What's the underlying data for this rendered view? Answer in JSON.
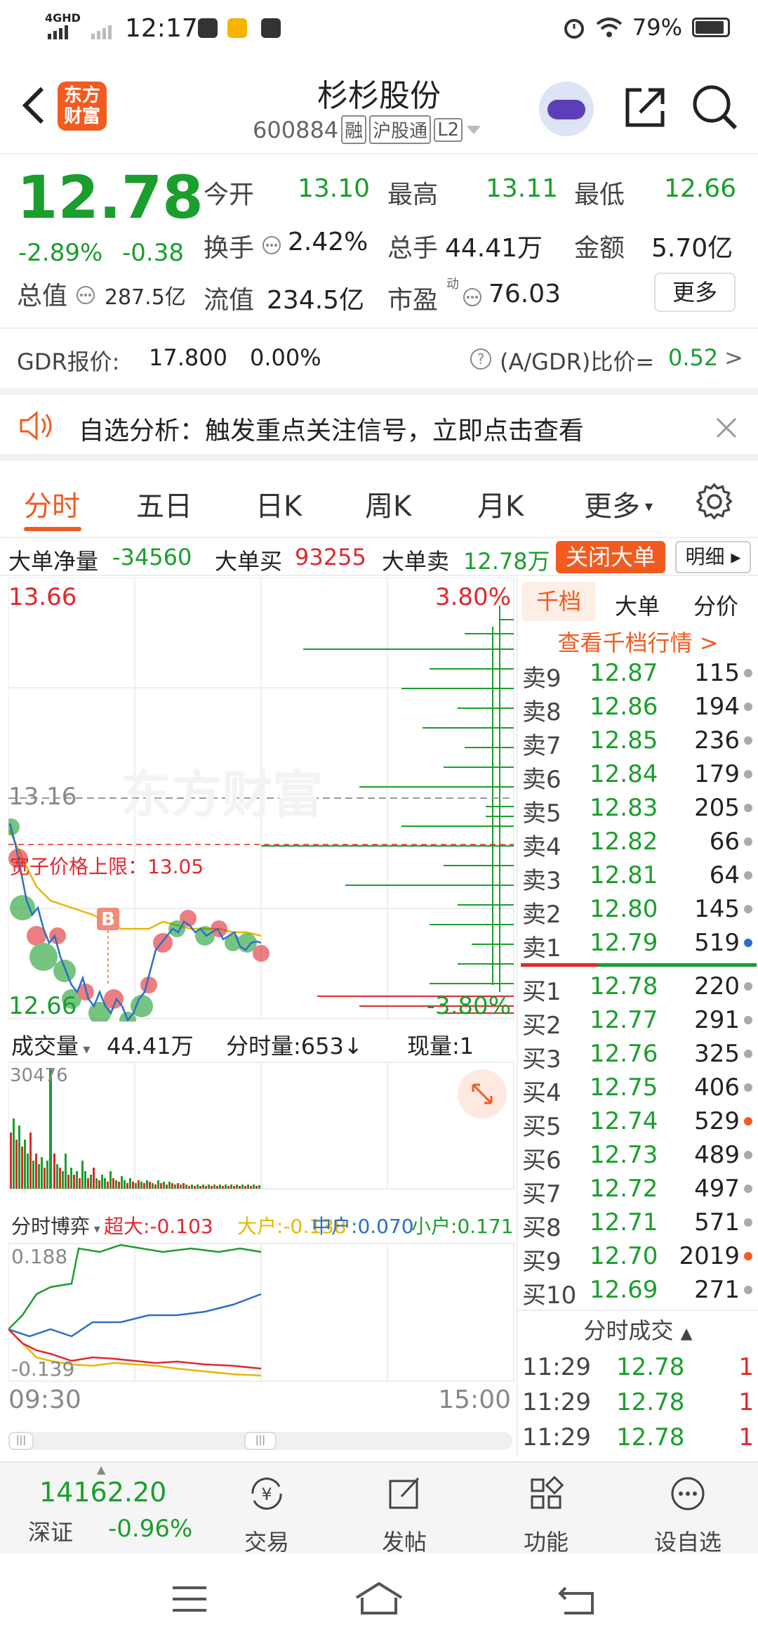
{
  "status_bar": {
    "network": "4GHD",
    "time": "12:17",
    "battery": "79%"
  },
  "header": {
    "logo_text": "东方\n财富",
    "title": "杉杉股份",
    "code": "600884",
    "tags": [
      "融",
      "沪股通",
      "L2"
    ]
  },
  "quote": {
    "price": "12.78",
    "change_pct": "-2.89%",
    "change": "-0.38",
    "fields": [
      {
        "label": "今开",
        "value": "13.10",
        "color": "green"
      },
      {
        "label": "最高",
        "value": "13.11",
        "color": "green"
      },
      {
        "label": "最低",
        "value": "12.66",
        "color": "green"
      },
      {
        "label": "换手",
        "value": "2.42%",
        "color": "dark"
      },
      {
        "label": "总手",
        "value": "44.41万",
        "color": "dark"
      },
      {
        "label": "金额",
        "value": "5.70亿",
        "color": "dark"
      },
      {
        "label": "流值",
        "value": "234.5亿",
        "color": "dark"
      },
      {
        "label": "市盈",
        "value": "76.03",
        "color": "dark"
      }
    ],
    "total_cap_label": "总值",
    "total_cap_value": "287.5亿",
    "pe_mark": "动",
    "more": "更多"
  },
  "gdr": {
    "label": "GDR报价:",
    "price": "17.800",
    "pct": "0.00%",
    "ratio_label": "(A/GDR)比价=",
    "ratio": "0.52",
    "arrow": ">"
  },
  "banner": {
    "text": "自选分析：触发重点关注信号，立即点击查看"
  },
  "tabs": [
    "分时",
    "五日",
    "日K",
    "周K",
    "月K",
    "更多"
  ],
  "big_order": {
    "net_label": "大单净量",
    "net": "-34560",
    "buy_label": "大单买",
    "buy": "93255",
    "sell_label": "大单卖",
    "sell": "12.78万",
    "close": "关闭大单",
    "detail": "明细"
  },
  "chart": {
    "price_high": "13.66",
    "price_low": "12.66",
    "pct_high": "3.80%",
    "pct_low": "-3.80%",
    "prev_close": "13.16",
    "bond_limit_label": "宽子价格上限：13.05",
    "b_marker": "B",
    "watermark": "东方财富",
    "volume_label": "成交量",
    "volume_value": "44.41万",
    "tick_volume_label": "分时量:653↓",
    "now_volume_label": "现量:1",
    "vol_max": "30476",
    "game_label": "分时博弈",
    "game_items": [
      {
        "label": "超大:",
        "value": "-0.103",
        "color": "#e0282d"
      },
      {
        "label": "大户:",
        "value": "-0.138",
        "color": "#e6b800"
      },
      {
        "label": "中户:",
        "value": "0.070",
        "color": "#2a6fc9"
      },
      {
        "label": "小户:",
        "value": "0.171",
        "color": "#1a9e2c"
      }
    ],
    "game_max": "0.188",
    "game_min": "-0.139",
    "time_start": "09:30",
    "time_end": "15:00"
  },
  "orderbook": {
    "tabs": [
      "千档",
      "大单",
      "分价"
    ],
    "link": "查看千档行情 >",
    "asks": [
      {
        "label": "卖9",
        "price": "12.87",
        "vol": "115"
      },
      {
        "label": "卖8",
        "price": "12.86",
        "vol": "194"
      },
      {
        "label": "卖7",
        "price": "12.85",
        "vol": "236"
      },
      {
        "label": "卖6",
        "price": "12.84",
        "vol": "179"
      },
      {
        "label": "卖5",
        "price": "12.83",
        "vol": "205"
      },
      {
        "label": "卖4",
        "price": "12.82",
        "vol": "66"
      },
      {
        "label": "卖3",
        "price": "12.81",
        "vol": "64"
      },
      {
        "label": "卖2",
        "price": "12.80",
        "vol": "145"
      },
      {
        "label": "卖1",
        "price": "12.79",
        "vol": "519"
      }
    ],
    "bids": [
      {
        "label": "买1",
        "price": "12.78",
        "vol": "220"
      },
      {
        "label": "买2",
        "price": "12.77",
        "vol": "291"
      },
      {
        "label": "买3",
        "price": "12.76",
        "vol": "325"
      },
      {
        "label": "买4",
        "price": "12.75",
        "vol": "406"
      },
      {
        "label": "买5",
        "price": "12.74",
        "vol": "529"
      },
      {
        "label": "买6",
        "price": "12.73",
        "vol": "489"
      },
      {
        "label": "买7",
        "price": "12.72",
        "vol": "497"
      },
      {
        "label": "买8",
        "price": "12.71",
        "vol": "571"
      },
      {
        "label": "买9",
        "price": "12.70",
        "vol": "2019"
      },
      {
        "label": "买10",
        "price": "12.69",
        "vol": "271"
      }
    ],
    "trade_header": "分时成交",
    "trades": [
      {
        "time": "11:29",
        "price": "12.78",
        "qty": "1"
      },
      {
        "time": "11:29",
        "price": "12.78",
        "qty": "1"
      },
      {
        "time": "11:29",
        "price": "12.78",
        "qty": "1"
      }
    ]
  },
  "bottom_bar": {
    "index_value": "14162.20",
    "index_name": "深证",
    "index_pct": "-0.96%",
    "items": [
      "交易",
      "发帖",
      "功能",
      "设自选"
    ]
  }
}
